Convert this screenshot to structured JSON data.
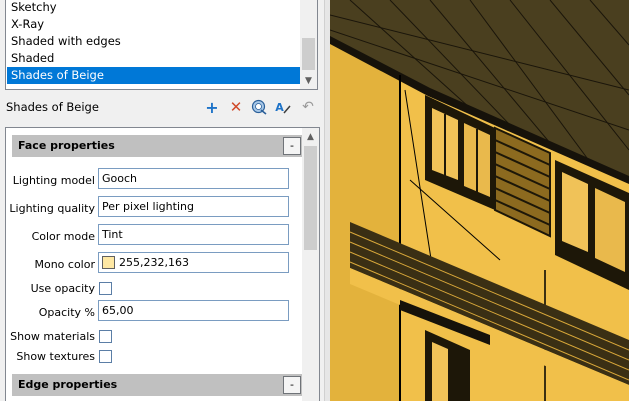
{
  "style_list": {
    "items": [
      "Sketchy",
      "X-Ray",
      "Shaded with edges",
      "Shaded",
      "Shades of Beige"
    ],
    "selected": "Shades of Beige"
  },
  "toolbar": {
    "current_style": "Shades of Beige",
    "add_symbol": "+",
    "delete_symbol": "✕",
    "rename_symbol": "A",
    "undo_symbol": "↶"
  },
  "face_properties": {
    "title": "Face properties",
    "collapse": "-",
    "lighting_model_label": "Lighting model",
    "lighting_model": "Gooch",
    "lighting_quality_label": "Lighting quality",
    "lighting_quality": "Per pixel lighting",
    "color_mode_label": "Color mode",
    "color_mode": "Tint",
    "mono_color_label": "Mono color",
    "mono_color": "255,232,163",
    "mono_color_hex": "#ffe8a3",
    "use_opacity_label": "Use opacity",
    "use_opacity": false,
    "opacity_label": "Opacity %",
    "opacity": "65,00",
    "show_materials_label": "Show materials",
    "show_materials": false,
    "show_textures_label": "Show textures",
    "show_textures": false
  },
  "edge_properties": {
    "title": "Edge properties",
    "collapse": "-"
  },
  "colors": {
    "selection": "#0078d7",
    "wall": "#e3b23c",
    "roof": "#4a3f1f"
  }
}
